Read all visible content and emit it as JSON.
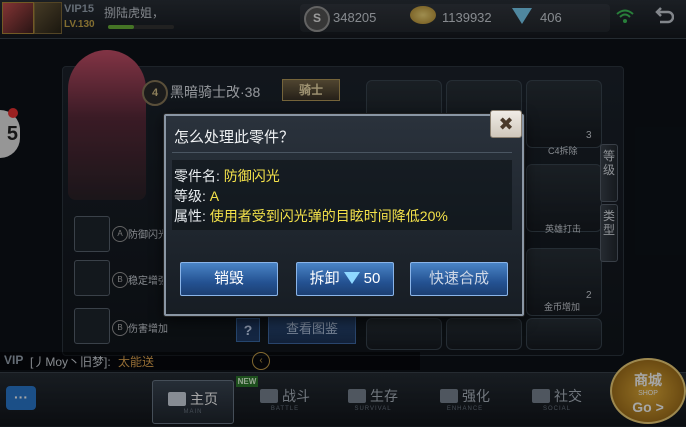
{
  "topbar": {
    "vip": "VIP15",
    "level": "LV.130",
    "username": "捌陆虎姐，",
    "s_currency_icon": "S",
    "s_currency": "348205",
    "gold": "1139932",
    "diamonds": "406"
  },
  "weapon": {
    "level_badge": "4",
    "name": "黑暗骑士改·38",
    "rank_badge": "骑士"
  },
  "left_slots": [
    {
      "badge": "A",
      "label": "防御闪光"
    },
    {
      "badge": "B",
      "label": "稳定增强"
    },
    {
      "badge": "B",
      "label": "伤害增加"
    }
  ],
  "help_label": "?",
  "gallery_button": "查看图鉴",
  "grid": {
    "c4_label": "C4拆除",
    "c4_count": "3",
    "hero_label": "英雄打击",
    "gold_label": "金币增加",
    "gold_count": "2"
  },
  "side_tabs": {
    "grade": "等级",
    "type": "类型"
  },
  "left_bubble": "5",
  "chat": {
    "vip": "VIP",
    "name": "[丿Moy丶旧梦]:",
    "message": "太能送",
    "toggle": "‹"
  },
  "nav": {
    "chat_button": "···",
    "new_badge": "NEW",
    "tabs": [
      {
        "label": "主页",
        "sub": "MAIN"
      },
      {
        "label": "战斗",
        "sub": "BATTLE"
      },
      {
        "label": "生存",
        "sub": "SURVIVAL"
      },
      {
        "label": "强化",
        "sub": "ENHANCE"
      },
      {
        "label": "社交",
        "sub": "SOCIAL"
      }
    ],
    "shop": {
      "label": "商城",
      "sub": "SHOP",
      "go": "Go >"
    }
  },
  "dialog": {
    "title": "怎么处理此零件？",
    "name_label": "零件名:",
    "name_value": "防御闪光",
    "level_label": "等级:",
    "level_value": "A",
    "attr_label": "属性:",
    "attr_value": "使用者受到闪光弹的目眩时间降低20%",
    "close": "✖",
    "btn_destroy": "销毁",
    "btn_dismantle": "拆卸",
    "dismantle_cost": "50",
    "btn_synth": "快速合成"
  },
  "colors": {
    "accent_yellow": "#f4e24a",
    "button_blue": "#245292",
    "chat_message": "#e2a650"
  }
}
